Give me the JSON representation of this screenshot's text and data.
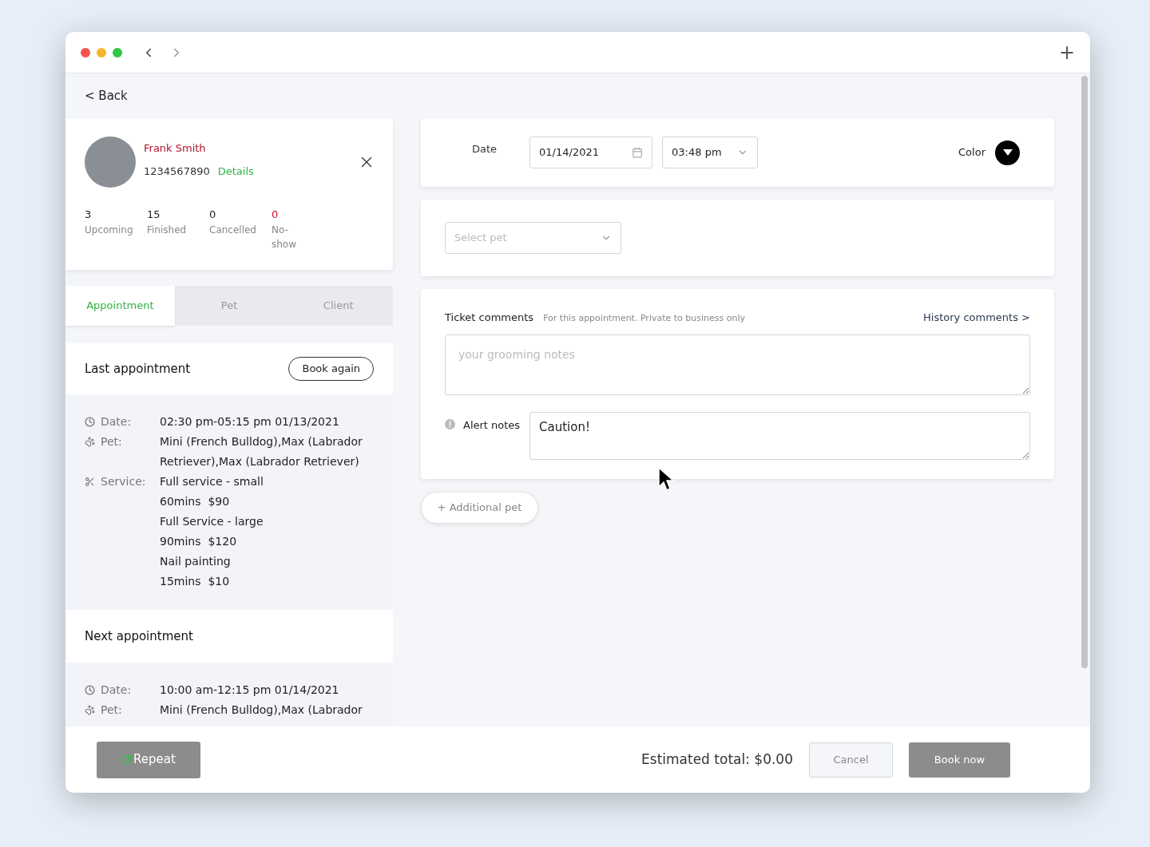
{
  "window": {
    "new_tab": "+"
  },
  "back_link": "< Back",
  "client": {
    "name": "Frank Smith",
    "phone": "1234567890",
    "details_link": "Details",
    "stats": [
      {
        "value": "3",
        "label": "Upcoming",
        "alert": false
      },
      {
        "value": "15",
        "label": "Finished",
        "alert": false
      },
      {
        "value": "0",
        "label": "Cancelled",
        "alert": false
      },
      {
        "value": "0",
        "label": "No-show",
        "alert": true
      }
    ]
  },
  "tabs": [
    {
      "label": "Appointment",
      "selected": true
    },
    {
      "label": "Pet",
      "selected": false
    },
    {
      "label": "Client",
      "selected": false
    }
  ],
  "last_appointment": {
    "title": "Last appointment",
    "button": "Book again",
    "rows": [
      {
        "kind": "date",
        "label": "Date:",
        "lines": [
          "02:30 pm-05:15 pm 01/13/2021"
        ]
      },
      {
        "kind": "pet",
        "label": "Pet:",
        "lines": [
          "Mini (French Bulldog),Max (Labrador",
          "Retriever),Max (Labrador Retriever)"
        ]
      },
      {
        "kind": "service",
        "label": "Service:",
        "lines": [
          "Full service - small",
          "60mins  $90",
          "Full Service - large",
          "90mins  $120",
          "Nail painting",
          "15mins  $10"
        ]
      }
    ]
  },
  "next_appointment": {
    "title": "Next appointment",
    "rows": [
      {
        "kind": "date",
        "label": "Date:",
        "lines": [
          "10:00 am-12:15 pm 01/14/2021"
        ]
      },
      {
        "kind": "pet",
        "label": "Pet:",
        "lines": [
          "Mini (French Bulldog),Max (Labrador"
        ]
      }
    ]
  },
  "schedule": {
    "date_label": "Date",
    "date": "01/14/2021",
    "time": "03:48 pm",
    "color_label": "Color"
  },
  "pet_select": {
    "placeholder": "Select pet"
  },
  "comments": {
    "title": "Ticket comments",
    "hint": "For this appointment. Private to business only",
    "history_link": "History comments >",
    "notes_placeholder": "your grooming notes",
    "alert_label": "Alert notes",
    "alert_value": "Caution!"
  },
  "additional_pet": "+ Additional pet",
  "footer": {
    "repeat": "Repeat",
    "total": "Estimated total: $0.00",
    "cancel": "Cancel",
    "book": "Book now"
  }
}
